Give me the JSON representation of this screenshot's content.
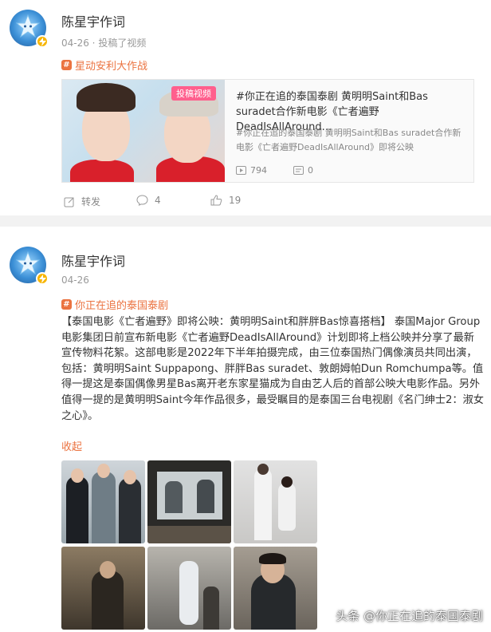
{
  "post1": {
    "author": "陈星宇作词",
    "meta": "04-26 · 投稿了视频",
    "topic": "星动安利大作战",
    "card": {
      "tag": "投稿视频",
      "title": "#你正在追的泰国泰剧 黄明明Saint和Bas suradet合作新电影《亡者遍野DeadIsAllAround...",
      "desc": "#你正在追的泰国泰剧 黄明明Saint和Bas suradet合作新电影《亡者遍野DeadIsAllAround》即将公映",
      "plays": "794",
      "comments": "0"
    },
    "actions": {
      "repost": "转发",
      "comment": "4",
      "like": "19"
    }
  },
  "post2": {
    "author": "陈星宇作词",
    "meta": "04-26",
    "topic": "你正在追的泰国泰剧",
    "body": "【泰国电影《亡者遍野》即将公映：黄明明Saint和胖胖Bas惊喜搭档】 泰国Major Group电影集团日前宣布新电影《亡者遍野DeadIsAllAround》计划即将上档公映并分享了最新宣传物料花絮。这部电影是2022年下半年拍摄完成，由三位泰国热门偶像演员共同出演，包括：黄明明Saint Suppapong、胖胖Bas suradet、敦朗姆帕Dun Romchumpa等。值得一提这是泰国偶像男星Bas离开老东家星猫成为自由艺人后的首部公映大电影作品。另外值得一提的是黄明明Saint今年作品很多，最受瞩目的是泰国三台电视剧《名门绅士2：淑女之心》。",
    "collapse": "收起"
  },
  "watermark": "头条 @你正在追的泰国泰剧",
  "colors": {
    "accent": "#eb7340",
    "badge": "#f7b500",
    "video_tag": "#ff5f8d"
  }
}
